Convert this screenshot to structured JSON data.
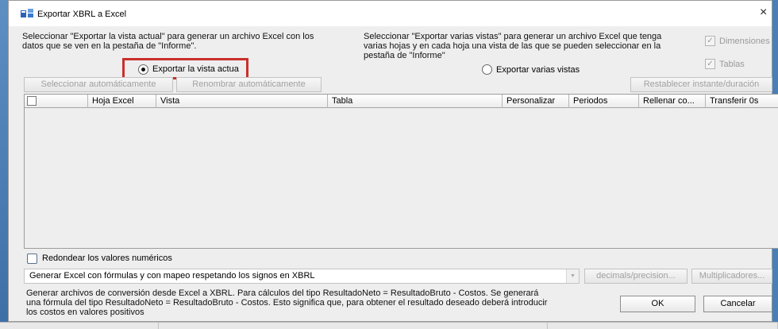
{
  "dialog": {
    "title": "Exportar XBRL a Excel",
    "close_glyph": "×"
  },
  "left_section": {
    "description_line1": "Seleccionar \"Exportar la vista actual\" para generar un archivo Excel con los",
    "description_line2": "datos que se ven en la pestaña de \"Informe\".",
    "radio_label": "Exportar la vista actua",
    "radio_selected": true
  },
  "right_section": {
    "description_line1": "Seleccionar \"Exportar varias vistas\" para generar un archivo Excel que tenga",
    "description_line2": "varias hojas y en cada hoja una vista de las que se pueden seleccionar en la",
    "description_line3": "pestaña de \"Informe\"",
    "radio_label": "Exportar varias vistas",
    "radio_selected": false
  },
  "options": {
    "dimensiones_label": "Dimensiones",
    "dimensiones_checked": true,
    "tablas_label": "Tablas",
    "tablas_checked": true
  },
  "toolbar": {
    "select_auto_label": "Seleccionar automáticamente",
    "rename_auto_label": "Renombrar automáticamente",
    "reset_label": "Restablecer instante/duración"
  },
  "table": {
    "columns": [
      "Hoja Excel",
      "Vista",
      "Tabla",
      "Personalizar",
      "Periodos",
      "Rellenar co...",
      "Transferir 0s"
    ],
    "rows": []
  },
  "round_values": {
    "label": "Redondear los valores numéricos",
    "checked": false
  },
  "mode_select": {
    "value": "Generar Excel con fórmulas y con mapeo respetando los signos en XBRL",
    "decimals_label": "decimals/precision...",
    "multipliers_label": "Multiplicadores..."
  },
  "footer": {
    "info_line1": "Generar archivos de conversión desde Excel a XBRL. Para cálculos del tipo ResultadoNeto = ResultadoBruto - Costos. Se generará",
    "info_line2": "una fórmula del tipo ResultadoNeto = ResultadoBruto - Costos. Esto significa que, para obtener el resultado deseado deberá introducir",
    "info_line3": "los costos en valores positivos",
    "ok_label": "OK",
    "cancel_label": "Cancelar"
  },
  "icons": {
    "title_icon": "xbrl-app-icon",
    "checkmark": "✓"
  }
}
